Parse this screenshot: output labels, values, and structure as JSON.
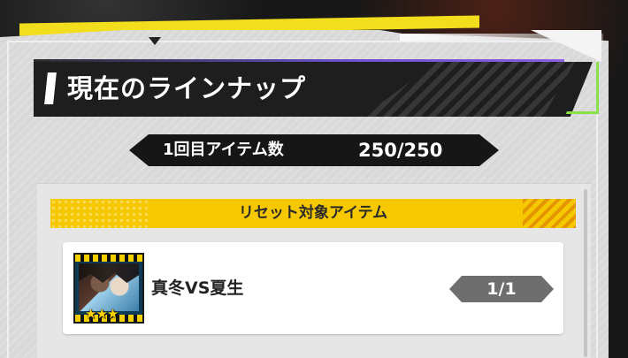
{
  "lineup": {
    "title": "現在のラインナップ"
  },
  "round_info": {
    "label": "1回目アイテム数",
    "value": "250/250"
  },
  "reset_section": {
    "title": "リセット対象アイテム",
    "items": [
      {
        "name": "真冬VS夏生",
        "quantity": "1/1",
        "rarity_stars": "★★★",
        "rarity": 3
      }
    ]
  },
  "colors": {
    "section_header": "#f6c800",
    "title_bar": "#1e1e1e",
    "panel": "#d9d9d9",
    "accent_green": "#8be04a",
    "accent_purple": "#8a5fe0",
    "top_strip": "#f2de1c"
  },
  "icons": {
    "title_marker": "bar-marker-icon"
  }
}
